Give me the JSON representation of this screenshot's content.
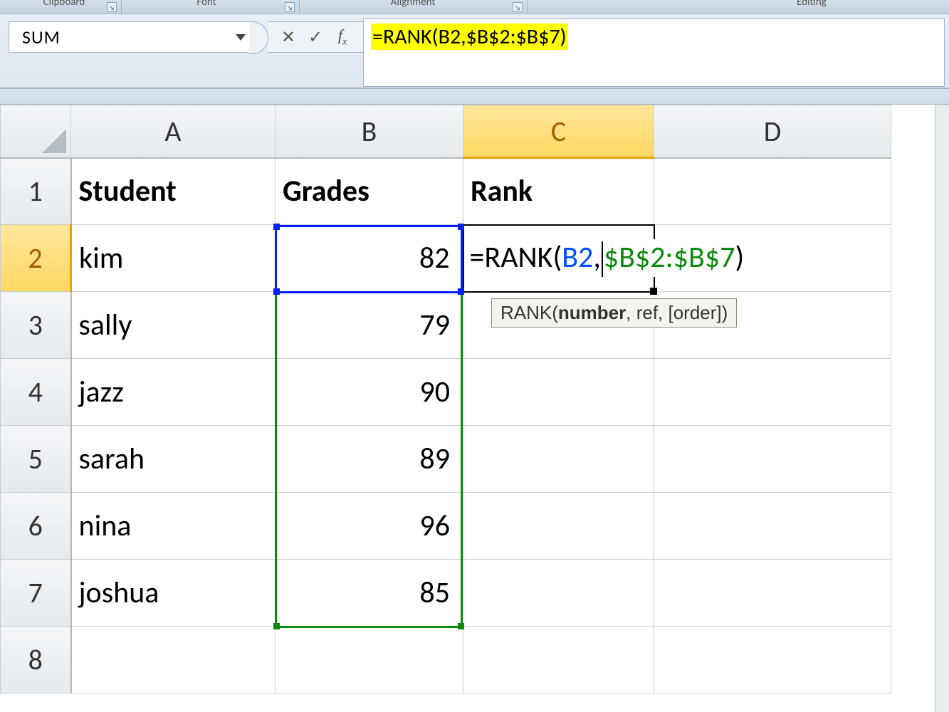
{
  "ribbon": {
    "groups": [
      "Clipboard",
      "Font",
      "Alignment",
      "Editing"
    ]
  },
  "namebox": {
    "value": "SUM"
  },
  "formula_bar": {
    "buttons": {
      "cancel": "✕",
      "enter": "✓"
    },
    "fx_label": "fx",
    "text": "=RANK(B2,$B$2:$B$7)"
  },
  "columns": [
    "A",
    "B",
    "C",
    "D"
  ],
  "row_numbers": [
    1,
    2,
    3,
    4,
    5,
    6,
    7,
    8
  ],
  "headers": [
    "Student",
    "Grades",
    "Rank"
  ],
  "rows": [
    {
      "student": "kim",
      "grade": 82
    },
    {
      "student": "sally",
      "grade": 79
    },
    {
      "student": "jazz",
      "grade": 90
    },
    {
      "student": "sarah",
      "grade": 89
    },
    {
      "student": "nina",
      "grade": 96
    },
    {
      "student": "joshua",
      "grade": 85
    }
  ],
  "editing_cell": {
    "ref": "C2",
    "formula_parts": {
      "p1": "=RANK(",
      "arg1": "B2",
      "sep": ",",
      "arg2": "$B$2:$B$7",
      "close": ")"
    }
  },
  "tooltip": {
    "fn": "RANK(",
    "bold_arg": "number",
    "rest": ", ref, [order])"
  },
  "reference_boxes": {
    "blue": "B2",
    "green": "B2:B7"
  }
}
